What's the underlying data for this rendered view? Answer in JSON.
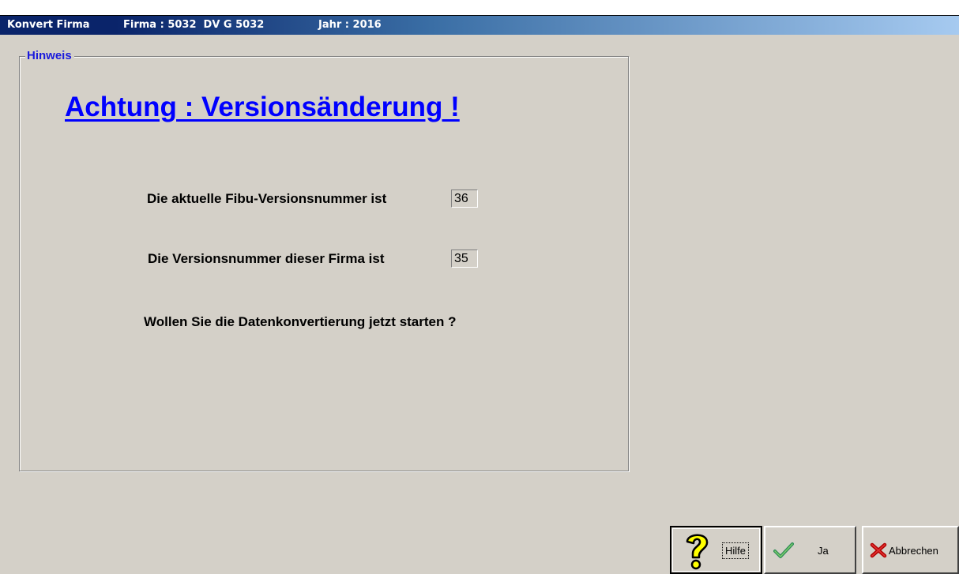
{
  "title_bar": {
    "app": "Konvert Firma",
    "firma": "Firma : 5032  DV G 5032",
    "jahr": "Jahr : 2016"
  },
  "groupbox": {
    "legend": "Hinweis"
  },
  "message": {
    "headline": "Achtung : Versionsänderung !",
    "current_version_label": "Die aktuelle Fibu-Versionsnummer ist",
    "current_version_value": "36",
    "company_version_label": "Die Versionsnummer dieser Firma ist",
    "company_version_value": "35",
    "question": "Wollen Sie die Datenkonvertierung jetzt starten ?"
  },
  "buttons": {
    "help": {
      "label": "Hilfe",
      "icon": "question-mark-icon"
    },
    "yes": {
      "label": "Ja",
      "icon": "checkmark-icon"
    },
    "cancel": {
      "label": "Abbrechen",
      "icon": "cross-icon"
    }
  },
  "colors": {
    "title_bar_start": "#0a246a",
    "title_bar_end": "#a6caf0",
    "legend": "#1a1adc",
    "headline": "#0000ff",
    "background": "#d4d0c8"
  }
}
